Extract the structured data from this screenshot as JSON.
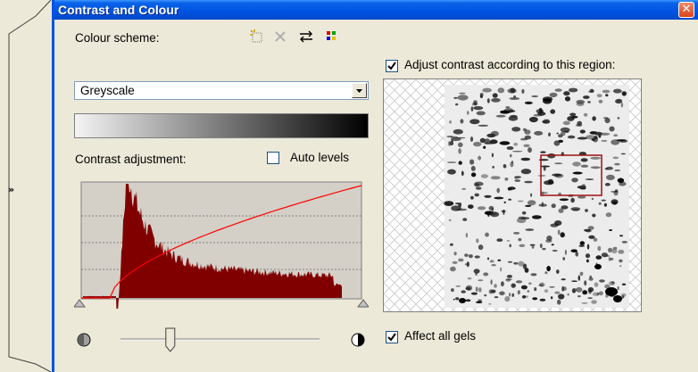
{
  "window": {
    "title": "Contrast and Colour",
    "close_glyph": "✕"
  },
  "side_strip": {
    "expand_glyph": "»"
  },
  "colour_scheme": {
    "label": "Colour scheme:",
    "selected": "Greyscale",
    "toolbar": [
      "new-scheme-icon",
      "delete-icon",
      "swap-icon",
      "palette-icon"
    ]
  },
  "contrast": {
    "label": "Contrast adjustment:",
    "auto_levels_label": "Auto levels",
    "auto_levels_checked": false,
    "curve_color": "#ff0000",
    "histogram_color": "#800000",
    "slider_position": 0.25
  },
  "region": {
    "adjust_label": "Adjust contrast according to this region:",
    "adjust_checked": true,
    "selection_color": "#a01010"
  },
  "affect_all": {
    "label": "Affect all gels",
    "checked": true
  }
}
